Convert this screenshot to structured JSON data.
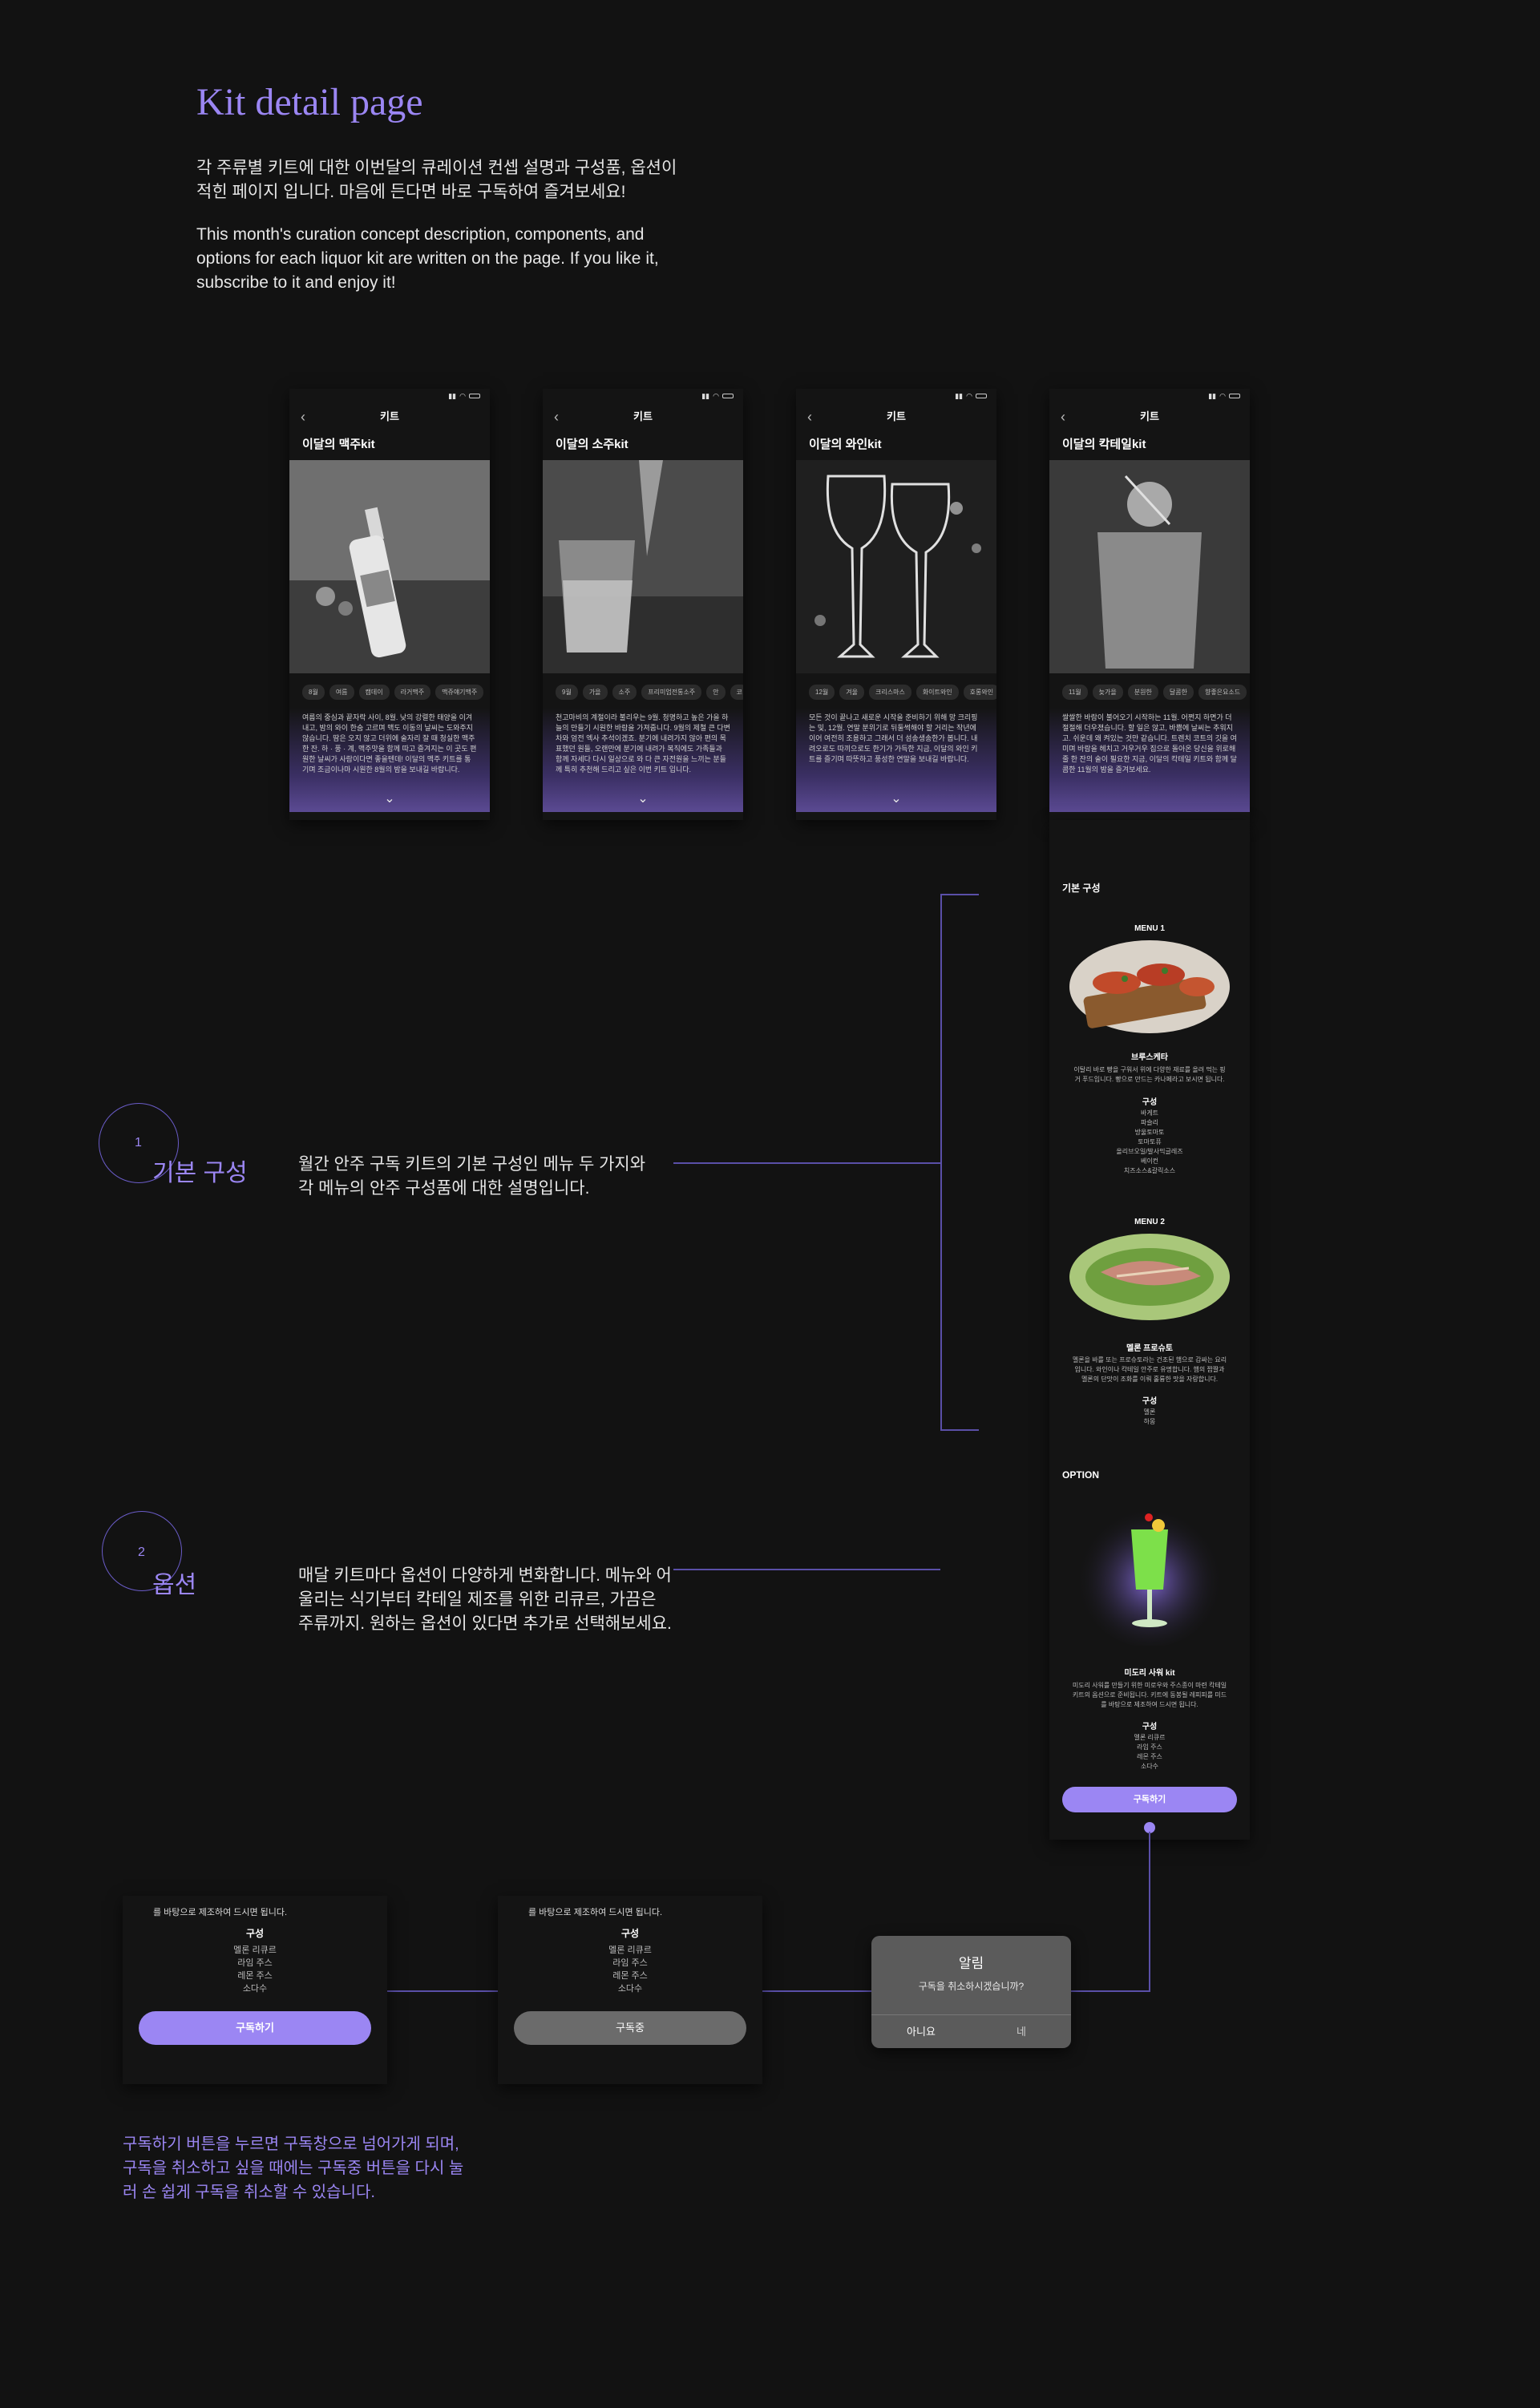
{
  "header": {
    "title": "Kit detail page",
    "desc_ko": "각 주류별 키트에 대한 이번달의 큐레이션 컨셉 설명과 구성품, 옵션이 적힌 페이지 입니다. 마음에 든다면 바로 구독하여 즐겨보세요!",
    "desc_en": "This month's curation concept description, components, and options for each liquor kit are written on the page. If you like it, subscribe to it and enjoy it!"
  },
  "screen_nav_title": "키트",
  "phones": [
    {
      "title": "이달의 맥주kit",
      "chips": [
        "8월",
        "여름",
        "캠데이",
        "라거맥주",
        "맥쥬얘기맥주"
      ],
      "desc": "여름의 중심과 끝자락 사이, 8월. 낮의 강렬한 태양을 이겨내고, 밤의 와이 한숨 고르며 맥도 이동의 날씨는 도와주지 않습니다. 땀은 오지 않고 더위에 술자리 잘 때 청실한 맥주 한 잔. 하 · 풍 · 계, 맥주맛을 함께 따고 즐겨지는 이 곳도 편원한 날씨가 사람이다면 좋을텐데! 이달의 맥주 키트를 통기며 조금이나마 시원한 8월의 밤을 보내길 바랍니다."
    },
    {
      "title": "이달의 소주kit",
      "chips": [
        "9월",
        "가을",
        "소주",
        "프리미엄전통소주",
        "안",
        "코"
      ],
      "desc": "천고마비의 계절이라 불리우는 9월. 청명하고 높은 가을 하늘의 만들기 시원한 바람을 가져줍니다. 9월의 제철 큰 다변차와 엄전 엑사 추석이겠죠. 분기에 내려가지 않아 편의 목표했던 원들, 오랜만에 분기에 내려가 복직에도 가족들과 함께 자세다 다시 일상으로 와 다 큰 자전원을 느끼는 분들께 특히 추천해 드리고 싶은 이번 키트 입니다."
    },
    {
      "title": "이달의 와인kit",
      "chips": [
        "12월",
        "겨울",
        "크리스마스",
        "화이트와인",
        "호롱와인"
      ],
      "desc": "모든 것이 끝나고 새로운 시작을 준비하기 위해 망 크리핑는 및, 12월. 연말 분위기로 뒤둘썩해야 할 거리는 작년에 이어 여전히 조용하고 그래서 더 섬송생송한가 봅니다. 내려오로도 따끼으로도 한기가 가득한 지금, 이달의 와인 키트를 즐기며 따뜻하고 풍성한 연말을 보내길 바랍니다."
    },
    {
      "title": "이달의 칵테일kit",
      "chips": [
        "11월",
        "늦가을",
        "분원한",
        "달콤한",
        "향좋은요소드"
      ],
      "desc": "쌀쌀한 바람이 불어오기 시작하는 11월. 어쩐지 하면가 더 절절해 더우졌습니다. 할 일은 않고, 바쁨에 날씨는 추워지고. 쉬운데 왜 켜있는 것만 같습니다. 트렌치 코트의 깃을 여미며 바람을 헤치고 거우거우 집으로 돌아온 당신을 위로해 줄 한 잔의 술이 필요한 지금, 이달의 칵테일 키트와 함께 달콤한 11월의 밤을 즐겨보세요."
    }
  ],
  "section1": {
    "num": "1",
    "label": "기본 구성",
    "desc": "월간 안주 구독 키트의 기본 구성인 메뉴 두 가지와 각 메뉴의 안주 구성품에 대한 설명입니다."
  },
  "section2": {
    "num": "2",
    "label": "옵션",
    "desc": "매달 키트마다 옵션이 다양하게 변화합니다. 메뉴와 어울리는 식기부터 칵테일 제조를 위한 리큐르, 가끔은 주류까지. 원하는 옵션이 있다면 추가로 선택해보세요."
  },
  "detail": {
    "basic_heading": "기본 구성",
    "menu1": {
      "label": "MENU 1",
      "name": "브루스케타",
      "desc": "이탈리 바로 빵을 구워서 위에 다양한 재료를 올려 먹는 핑거 푸드입니다. 빵으로 만드는 카나페라고 보시면 됩니다.",
      "comp_heading": "구성",
      "items": [
        "바게트",
        "파슬리",
        "방울토마토",
        "토마토퓨",
        "올리브오일/발사믹글레즈",
        "베이컨",
        "치즈소스&갈릭소스"
      ]
    },
    "menu2": {
      "label": "MENU 2",
      "name": "멜론 프로슈토",
      "desc": "멜론을 바를 또는 프로슈토라는 건조된 햄으로 감싸는 요리입니다. 와인이나 칵테일 안주로 유명합니다. 햄의 짭짤과 멜론의 단맛이 조화를 이뤄 훌륭한 맛을 자랑합니다.",
      "comp_heading": "구성",
      "items": [
        "멜론",
        "하몽"
      ]
    },
    "option_heading": "OPTION",
    "option": {
      "name": "미도리 사워 kit",
      "desc": "미도리 사워를 만들기 위한 미로우와 주스종이 마련 칵테일 키트의 옵션으로 준비됩니다. 키트에 동봉될 레피피를 미드를 바탕으로 제조하여 드시면 됩니다.",
      "comp_heading": "구성",
      "items": [
        "멜론 리큐르",
        "라임 주스",
        "레몬 주스",
        "소다수"
      ]
    },
    "subscribe": "구독하기"
  },
  "cards": {
    "top_text": "를 바탕으로 제조하여 드시면 됩니다.",
    "comp_heading": "구성",
    "items": [
      "멜론 리큐르",
      "라임 주스",
      "레몬 주스",
      "소다수"
    ],
    "btn_subscribe": "구독하기",
    "btn_subscribed": "구독중"
  },
  "dialog": {
    "title": "알림",
    "message": "구독을 취소하시겠습니까?",
    "no": "아니요",
    "yes": "네"
  },
  "footnote": "구독하기 버튼을 누르면 구독창으로 넘어가게 되며, 구독을 취소하고 싶을 때에는 구독중 버튼을 다시 눌러 손 쉽게 구독을 취소할 수 있습니다.",
  "colors": {
    "accent": "#9b86f3",
    "bg": "#121212",
    "panel": "#141414"
  }
}
